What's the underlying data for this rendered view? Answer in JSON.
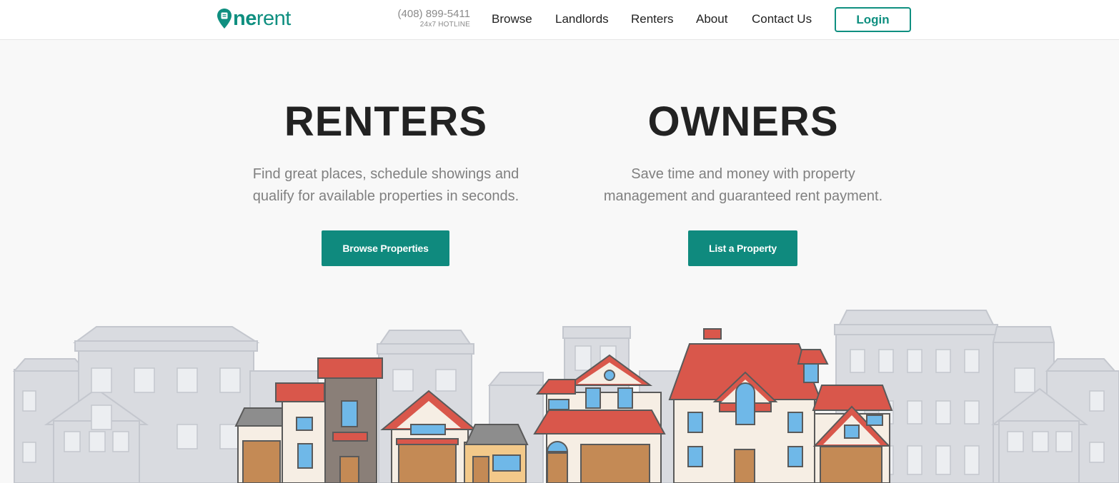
{
  "header": {
    "logo_text_bold": "ne",
    "logo_text_light": "rent",
    "phone_number": "(408) 899-5411",
    "phone_caption": "24x7 HOTLINE",
    "nav": [
      "Browse",
      "Landlords",
      "Renters",
      "About",
      "Contact Us"
    ],
    "login_label": "Login"
  },
  "hero": {
    "renters": {
      "title": "RENTERS",
      "line1": "Find great places, schedule showings and",
      "line2": "qualify for available properties in seconds.",
      "button": "Browse Properties"
    },
    "owners": {
      "title": "OWNERS",
      "line1": "Save time and money with property",
      "line2": "management and guaranteed rent payment.",
      "button": "List a Property"
    }
  },
  "colors": {
    "brand": "#0f8f80",
    "button": "#0f8a7e",
    "roof": "#d9574b",
    "background_buildings": "#d9dbe0"
  },
  "icons": [
    "map-pin-logo-icon"
  ]
}
